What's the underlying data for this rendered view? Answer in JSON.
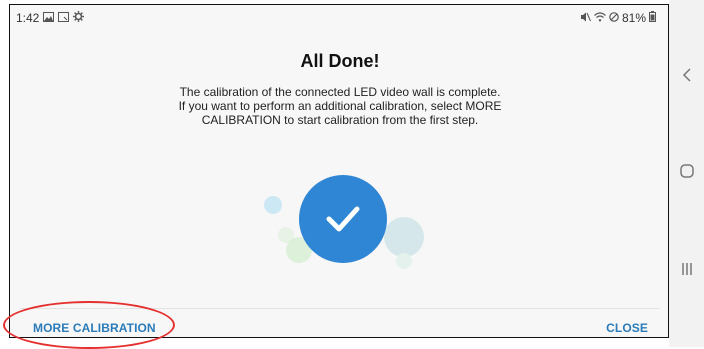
{
  "status_bar": {
    "time": "1:42",
    "battery": "81%",
    "left_icons": [
      "gallery-icon",
      "screenshot-icon",
      "settings-icon"
    ],
    "right_icons": [
      "mute-icon",
      "wifi-icon",
      "no-disturb-icon",
      "battery-icon"
    ]
  },
  "dialog": {
    "title": "All Done!",
    "description_lines": [
      "The calibration of the connected LED video wall is complete.",
      "If you want to perform an additional calibration, select MORE",
      "CALIBRATION to start calibration from the first step."
    ],
    "illustration_icon": "checkmark-icon",
    "accent_color": "#2e86d4"
  },
  "footer": {
    "more_label": "MORE CALIBRATION",
    "close_label": "CLOSE",
    "button_color": "#2b7bb9"
  },
  "annotation": {
    "highlight_color": "#e4312f",
    "highlight_shape": "ellipse"
  },
  "nav_bar": {
    "back_icon": "back-chevron-icon",
    "home_icon": "home-icon",
    "recents_icon": "recents-icon"
  }
}
